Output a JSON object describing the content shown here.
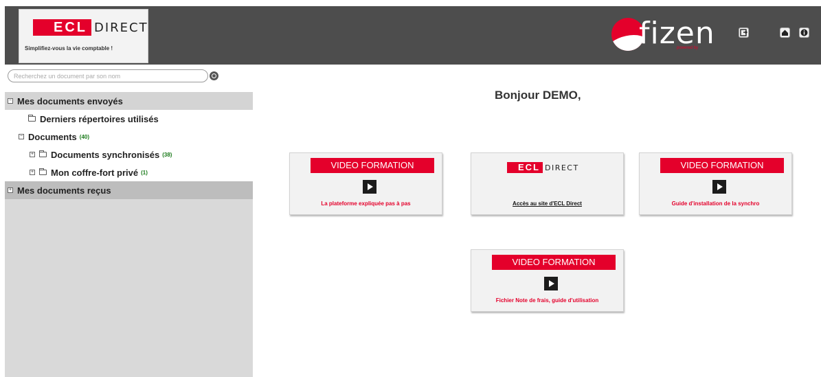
{
  "header": {
    "logo": {
      "brand_red": "ECL",
      "brand_dark": "DIRECT",
      "tagline": "Simplifiez-vous la vie comptable !"
    },
    "fizen": {
      "name": "fizen",
      "sub": "powered by"
    },
    "icons": [
      "export-icon",
      "home-icon",
      "info-icon"
    ]
  },
  "sidebar": {
    "search": {
      "placeholder": "Recherchez un document par son nom"
    },
    "sections": {
      "sent": {
        "label": "Mes documents envoyés",
        "toggle": "⊟"
      },
      "recent": {
        "label": "Derniers répertoires utilisés"
      },
      "documents": {
        "label": "Documents",
        "count": "(40)",
        "toggle": "⊟"
      },
      "synced": {
        "label": "Documents synchronisés",
        "count": "(38)",
        "toggle": "⊞"
      },
      "vault": {
        "label": "Mon coffre-fort privé",
        "count": "(1)",
        "toggle": "⊞"
      },
      "received": {
        "label": "Mes documents reçus",
        "toggle": "⊞"
      }
    }
  },
  "main": {
    "greeting": "Bonjour DEMO,",
    "cards": [
      {
        "banner": "VIDEO FORMATION",
        "caption": "La plateforme expliquée pas à pas"
      },
      {
        "brand_red": "ECL",
        "brand_dark": "DIRECT",
        "caption": "Accès au site d'ECL Direct"
      },
      {
        "banner": "VIDEO FORMATION",
        "caption": "Guide d'installation de la synchro"
      },
      {
        "banner": "VIDEO FORMATION",
        "caption": "Fichier Note de frais, guide d'utilisation"
      }
    ]
  },
  "colors": {
    "brand_red": "#e4002b",
    "header_bg": "#4d4d4d",
    "sidebar_bg": "#d9d9d9",
    "count_green": "#1a7a1a"
  }
}
